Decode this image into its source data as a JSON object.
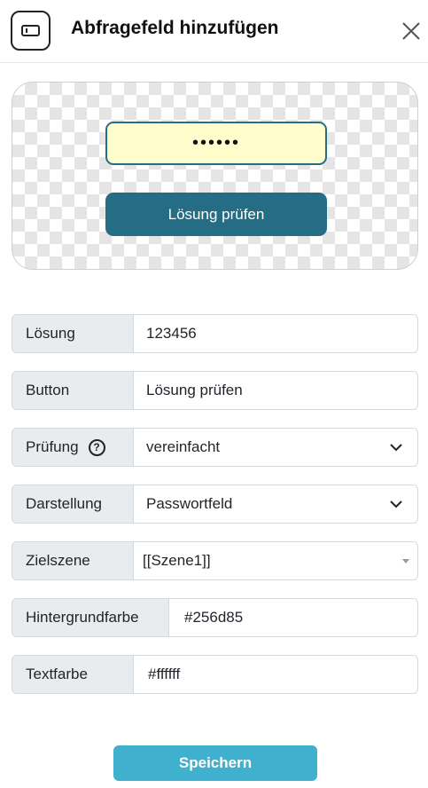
{
  "dialog": {
    "title": "Abfragefeld hinzufügen",
    "icon": "input-field-icon",
    "close_icon": "close-icon"
  },
  "preview": {
    "password_mask": "••••••",
    "button_label": "Lösung prüfen",
    "field_background": "#fffdcc",
    "button_color": "#256d85"
  },
  "form": {
    "solution": {
      "label": "Lösung",
      "value": "123456"
    },
    "button": {
      "label": "Button",
      "value": "Lösung prüfen"
    },
    "check": {
      "label": "Prüfung",
      "value": "vereinfacht",
      "help_icon": "question-icon"
    },
    "display": {
      "label": "Darstellung",
      "value": "Passwortfeld"
    },
    "target_scene": {
      "label": "Zielszene",
      "value": "[[Szene1]]"
    },
    "background_color": {
      "label": "Hintergrundfarbe",
      "value": "#256d85"
    },
    "text_color": {
      "label": "Textfarbe",
      "value": "#ffffff"
    }
  },
  "footer": {
    "save_label": "Speichern",
    "save_color": "#3fb0cd"
  }
}
